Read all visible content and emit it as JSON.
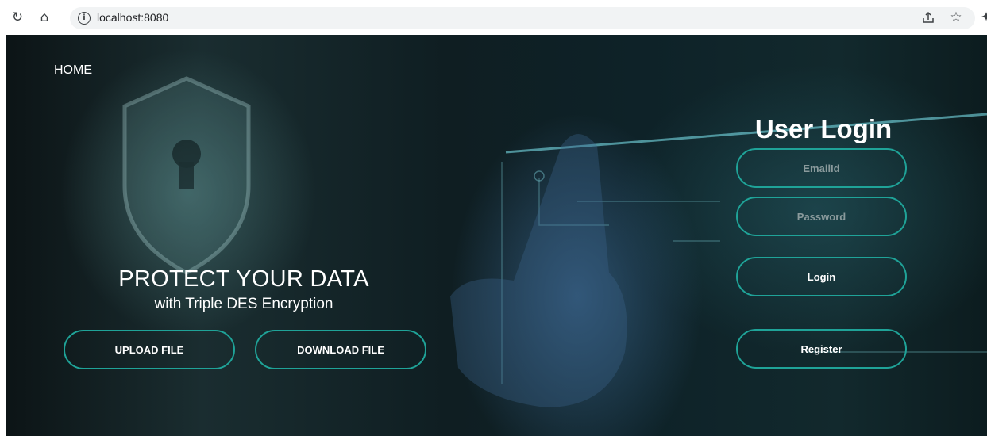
{
  "browser": {
    "url": "localhost:8080",
    "icons": [
      "reload-icon",
      "home-icon",
      "info-icon",
      "share-icon",
      "star-icon",
      "extension-icon"
    ]
  },
  "nav": {
    "home_label": "HOME"
  },
  "hero": {
    "title": "PROTECT YOUR DATA",
    "subtitle": "with Triple DES Encryption",
    "upload_label": "UPLOAD FILE",
    "download_label": "DOWNLOAD FILE"
  },
  "login": {
    "title": "User Login",
    "email_placeholder": "EmailId",
    "password_placeholder": "Password",
    "login_label": "Login",
    "register_label": "Register"
  },
  "colors": {
    "accent": "#1fa398",
    "background": "#0f1e22"
  }
}
